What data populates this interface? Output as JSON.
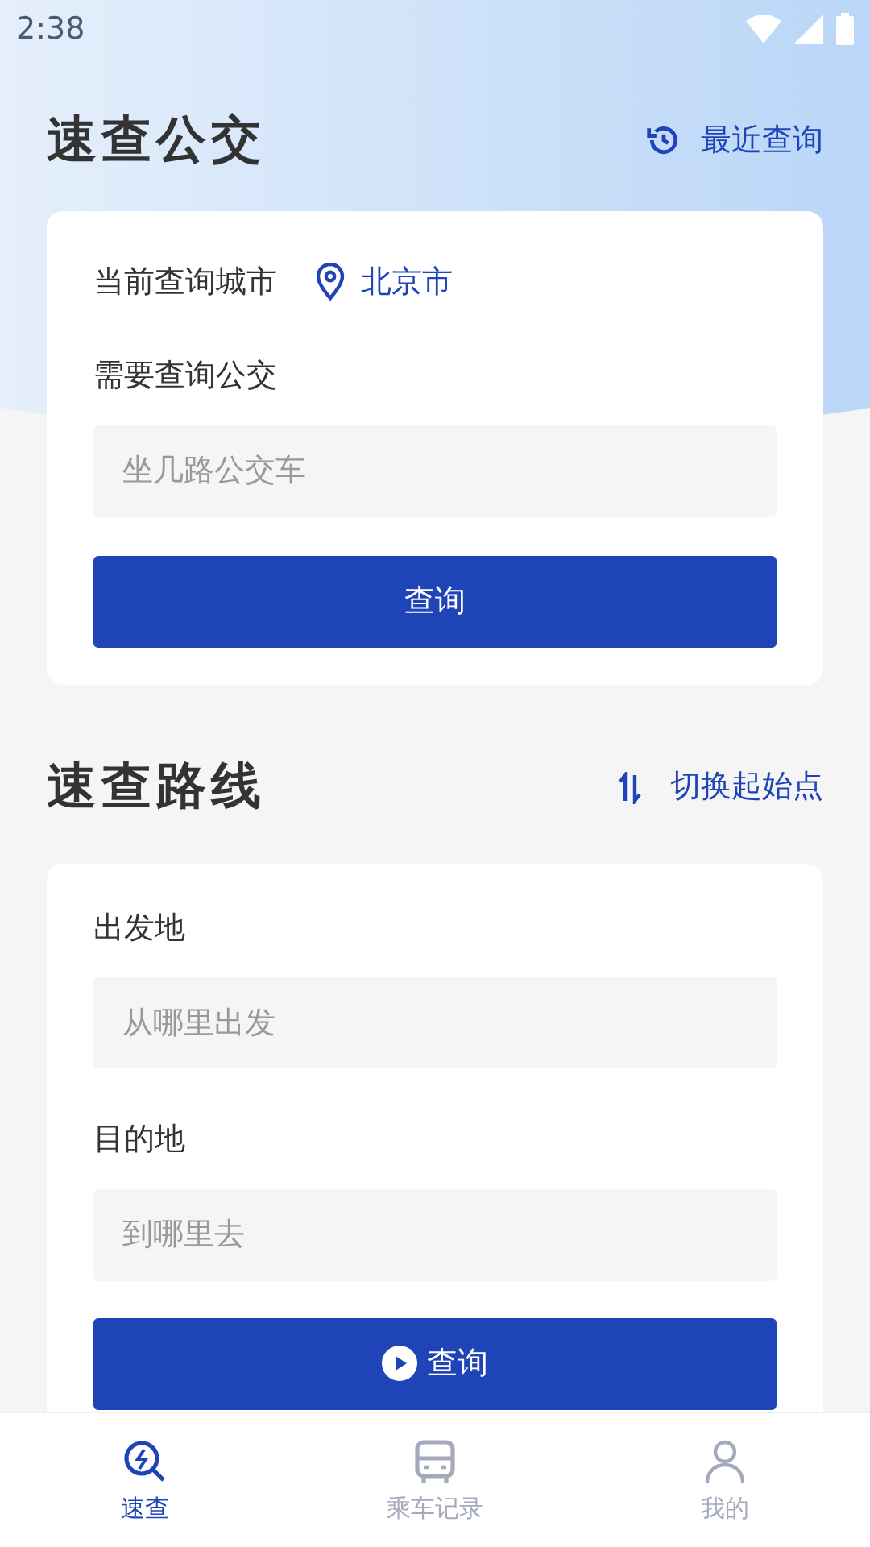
{
  "status_bar": {
    "time": "2:38"
  },
  "bus_section": {
    "title": "速查公交",
    "action": "最近查询",
    "city_label": "当前查询城市",
    "city": "北京市",
    "bus_label": "需要查询公交",
    "bus_placeholder": "坐几路公交车",
    "button": "查询"
  },
  "route_section": {
    "title": "速查路线",
    "action": "切换起始点",
    "from_label": "出发地",
    "from_placeholder": "从哪里出发",
    "to_label": "目的地",
    "to_placeholder": "到哪里去",
    "button": "查询"
  },
  "tab_bar": [
    {
      "label": "速查",
      "kind": "search",
      "selected": true
    },
    {
      "label": "乘车记录",
      "kind": "bus",
      "selected": false
    },
    {
      "label": "我的",
      "kind": "person",
      "selected": false
    }
  ]
}
